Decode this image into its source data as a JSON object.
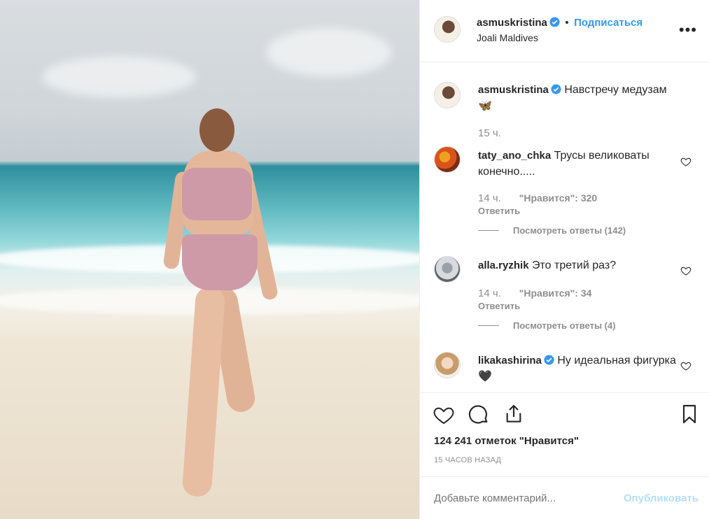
{
  "post": {
    "author": "asmuskristina",
    "follow_label": "Подписаться",
    "location": "Joali Maldives",
    "caption": "Навстречу медузам",
    "caption_emoji": "🦋",
    "caption_time": "15 ч.",
    "likes_text": "124 241 отметок \"Нравится\"",
    "timestamp": "15 ЧАСОВ НАЗАД"
  },
  "comments": [
    {
      "username": "taty_ano_chka",
      "text": "Трусы великоваты конечно.....",
      "time": "14 ч.",
      "likes": "\"Нравится\": 320",
      "reply": "Ответить",
      "view_replies": "Посмотреть ответы (142)"
    },
    {
      "username": "alla.ryzhik",
      "text": "Это третий раз?",
      "time": "14 ч.",
      "likes": "\"Нравится\": 34",
      "reply": "Ответить",
      "view_replies": "Посмотреть ответы (4)"
    },
    {
      "username": "likakashirina",
      "text": "Ну идеальная фигурка🖤",
      "verified": true
    }
  ],
  "add_comment": {
    "placeholder": "Добавьте комментарий...",
    "post_label": "Опубликовать"
  },
  "colors": {
    "accent": "#3897f0",
    "verified": "#3897f0",
    "muted": "#8e8e8e"
  }
}
